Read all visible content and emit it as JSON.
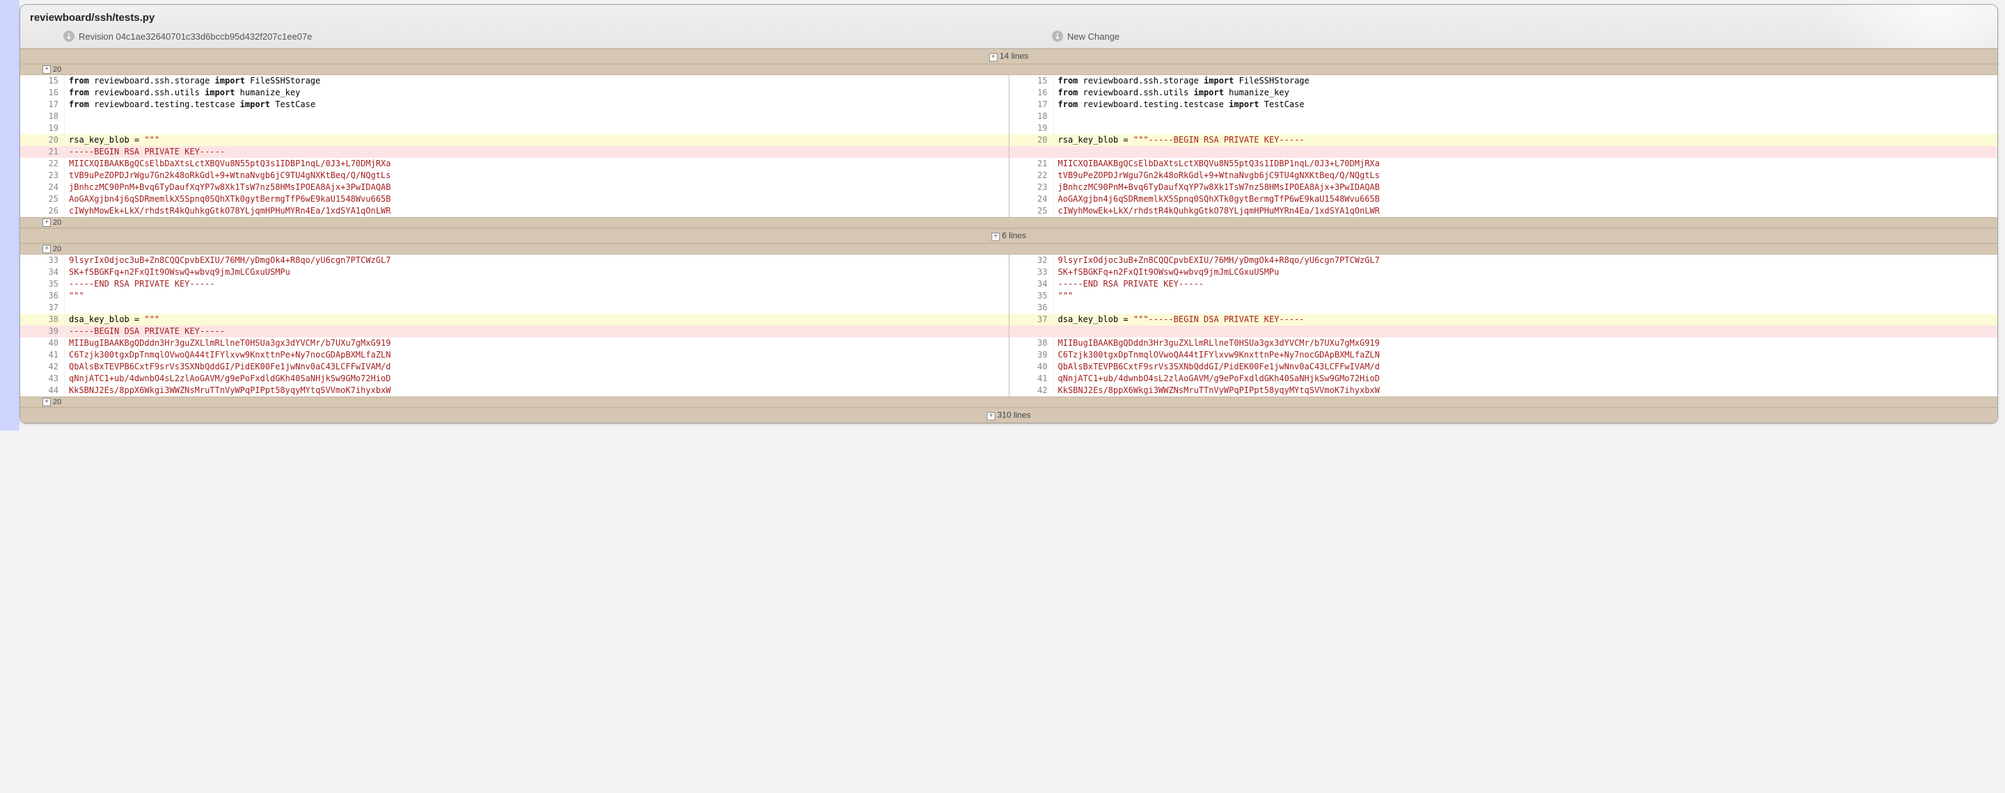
{
  "header": {
    "filepath": "reviewboard/ssh/tests.py",
    "revision_label": "Revision 04c1ae32640701c33d6bccb95d432f207c1ee07e",
    "newchange_label": "New Change"
  },
  "expand_count": "20",
  "bands": {
    "top": "14 lines",
    "mid": "6 lines",
    "bottom": "310 lines"
  },
  "left": {
    "block1": [
      {
        "n": "15",
        "segs": [
          {
            "t": "kw",
            "v": "from"
          },
          {
            "t": "p",
            "v": " reviewboard.ssh.storage "
          },
          {
            "t": "kw",
            "v": "import"
          },
          {
            "t": "p",
            "v": " FileSSHStorage"
          }
        ]
      },
      {
        "n": "16",
        "segs": [
          {
            "t": "kw",
            "v": "from"
          },
          {
            "t": "p",
            "v": " reviewboard.ssh.utils "
          },
          {
            "t": "kw",
            "v": "import"
          },
          {
            "t": "p",
            "v": " humanize_key"
          }
        ]
      },
      {
        "n": "17",
        "segs": [
          {
            "t": "kw",
            "v": "from"
          },
          {
            "t": "p",
            "v": " reviewboard.testing.testcase "
          },
          {
            "t": "kw",
            "v": "import"
          },
          {
            "t": "p",
            "v": " TestCase"
          }
        ]
      },
      {
        "n": "18",
        "segs": []
      },
      {
        "n": "19",
        "segs": []
      },
      {
        "n": "20",
        "cls": "chg",
        "segs": [
          {
            "t": "p",
            "v": "rsa_key_blob = "
          },
          {
            "t": "str",
            "v": "\"\"\""
          }
        ]
      },
      {
        "n": "21",
        "cls": "del",
        "segs": [
          {
            "t": "str",
            "v": "-----BEGIN RSA PRIVATE KEY-----"
          }
        ]
      },
      {
        "n": "22",
        "segs": [
          {
            "t": "str",
            "v": "MIICXQIBAAKBgQCsElbDaXtsLctXBQVu8N55ptQ3s1IDBP1nqL/0J3+L70DMjRXa"
          }
        ]
      },
      {
        "n": "23",
        "segs": [
          {
            "t": "str",
            "v": "tVB9uPeZOPDJrWgu7Gn2k48oRkGdl+9+WtnaNvgb6jC9TU4gNXKtBeq/Q/NQgtLs"
          }
        ]
      },
      {
        "n": "24",
        "segs": [
          {
            "t": "str",
            "v": "jBnhczMC90PnM+Bvq6TyDaufXqYP7w8Xk1TsW7nz58HMsIPOEA8Ajx+3PwIDAQAB"
          }
        ]
      },
      {
        "n": "25",
        "segs": [
          {
            "t": "str",
            "v": "AoGAXgjbn4j6qSDRmemlkX5Spnq0SQhXTk0gytBermgTfP6wE9kaU1548Wvu665B"
          }
        ]
      },
      {
        "n": "26",
        "segs": [
          {
            "t": "str",
            "v": "cIWyhMowEk+LkX/rhdstR4kQuhkgGtkO78YLjqmHPHuMYRn4Ea/1xdSYA1qOnLWR"
          }
        ]
      }
    ],
    "block2": [
      {
        "n": "33",
        "segs": [
          {
            "t": "str",
            "v": "9lsyrIxOdjoc3uB+Zn8CQQCpvbEXIU/76MH/yDmgOk4+R8qo/yU6cgn7PTCWzGL7"
          }
        ]
      },
      {
        "n": "34",
        "segs": [
          {
            "t": "str",
            "v": "SK+fSBGKFq+n2FxQIt9OWswQ+wbvq9jmJmLCGxuUSMPu"
          }
        ]
      },
      {
        "n": "35",
        "segs": [
          {
            "t": "str",
            "v": "-----END RSA PRIVATE KEY-----"
          }
        ]
      },
      {
        "n": "36",
        "segs": [
          {
            "t": "str",
            "v": "\"\"\""
          }
        ]
      },
      {
        "n": "37",
        "segs": []
      },
      {
        "n": "38",
        "cls": "chg",
        "segs": [
          {
            "t": "p",
            "v": "dsa_key_blob = "
          },
          {
            "t": "str",
            "v": "\"\"\""
          }
        ]
      },
      {
        "n": "39",
        "cls": "del",
        "segs": [
          {
            "t": "str",
            "v": "-----BEGIN DSA PRIVATE KEY-----"
          }
        ]
      },
      {
        "n": "40",
        "segs": [
          {
            "t": "str",
            "v": "MIIBugIBAAKBgQDddn3Hr3guZXLlmRLlneT0HSUa3gx3dYVCMr/b7UXu7gMxG919"
          }
        ]
      },
      {
        "n": "41",
        "segs": [
          {
            "t": "str",
            "v": "C6Tzjk300tgxDpTnmqlOVwoQA44tIFYlxvw9KnxttnPe+Ny7nocGDApBXMLfaZLN"
          }
        ]
      },
      {
        "n": "42",
        "segs": [
          {
            "t": "str",
            "v": "QbAlsBxTEVPB6CxtF9srVs3SXNbQddGI/PidEK00Fe1jwNnv0aC43LCFFwIVAM/d"
          }
        ]
      },
      {
        "n": "43",
        "segs": [
          {
            "t": "str",
            "v": "qNnjATC1+ub/4dwnbO4sL2zlAoGAVM/g9ePoFxdldGKh40SaNHjkSw9GMo72HioD"
          }
        ]
      },
      {
        "n": "44",
        "segs": [
          {
            "t": "str",
            "v": "KkSBNJ2Es/8ppX6Wkgi3WWZNsMruTTnVyWPqPIPpt58yqyMYtqSVVmoK7ihyxbxW"
          }
        ]
      }
    ]
  },
  "right": {
    "block1": [
      {
        "n": "15",
        "segs": [
          {
            "t": "kw",
            "v": "from"
          },
          {
            "t": "p",
            "v": " reviewboard.ssh.storage "
          },
          {
            "t": "kw",
            "v": "import"
          },
          {
            "t": "p",
            "v": " FileSSHStorage"
          }
        ]
      },
      {
        "n": "16",
        "segs": [
          {
            "t": "kw",
            "v": "from"
          },
          {
            "t": "p",
            "v": " reviewboard.ssh.utils "
          },
          {
            "t": "kw",
            "v": "import"
          },
          {
            "t": "p",
            "v": " humanize_key"
          }
        ]
      },
      {
        "n": "17",
        "segs": [
          {
            "t": "kw",
            "v": "from"
          },
          {
            "t": "p",
            "v": " reviewboard.testing.testcase "
          },
          {
            "t": "kw",
            "v": "import"
          },
          {
            "t": "p",
            "v": " TestCase"
          }
        ]
      },
      {
        "n": "18",
        "segs": []
      },
      {
        "n": "19",
        "segs": []
      },
      {
        "n": "20",
        "cls": "chg",
        "segs": [
          {
            "t": "p",
            "v": "rsa_key_blob = "
          },
          {
            "t": "str",
            "v": "\"\"\"-----BEGIN RSA PRIVATE KEY-----"
          }
        ]
      },
      {
        "n": "",
        "cls": "del",
        "segs": []
      },
      {
        "n": "21",
        "segs": [
          {
            "t": "str",
            "v": "MIICXQIBAAKBgQCsElbDaXtsLctXBQVu8N55ptQ3s1IDBP1nqL/0J3+L70DMjRXa"
          }
        ]
      },
      {
        "n": "22",
        "segs": [
          {
            "t": "str",
            "v": "tVB9uPeZOPDJrWgu7Gn2k48oRkGdl+9+WtnaNvgb6jC9TU4gNXKtBeq/Q/NQgtLs"
          }
        ]
      },
      {
        "n": "23",
        "segs": [
          {
            "t": "str",
            "v": "jBnhczMC90PnM+Bvq6TyDaufXqYP7w8Xk1TsW7nz58HMsIPOEA8Ajx+3PwIDAQAB"
          }
        ]
      },
      {
        "n": "24",
        "segs": [
          {
            "t": "str",
            "v": "AoGAXgjbn4j6qSDRmemlkX5Spnq0SQhXTk0gytBermgTfP6wE9kaU1548Wvu665B"
          }
        ]
      },
      {
        "n": "25",
        "segs": [
          {
            "t": "str",
            "v": "cIWyhMowEk+LkX/rhdstR4kQuhkgGtkO78YLjqmHPHuMYRn4Ea/1xdSYA1qOnLWR"
          }
        ]
      }
    ],
    "block2": [
      {
        "n": "32",
        "segs": [
          {
            "t": "str",
            "v": "9lsyrIxOdjoc3uB+Zn8CQQCpvbEXIU/76MH/yDmgOk4+R8qo/yU6cgn7PTCWzGL7"
          }
        ]
      },
      {
        "n": "33",
        "segs": [
          {
            "t": "str",
            "v": "SK+fSBGKFq+n2FxQIt9OWswQ+wbvq9jmJmLCGxuUSMPu"
          }
        ]
      },
      {
        "n": "34",
        "segs": [
          {
            "t": "str",
            "v": "-----END RSA PRIVATE KEY-----"
          }
        ]
      },
      {
        "n": "35",
        "segs": [
          {
            "t": "str",
            "v": "\"\"\""
          }
        ]
      },
      {
        "n": "36",
        "segs": []
      },
      {
        "n": "37",
        "cls": "chg",
        "segs": [
          {
            "t": "p",
            "v": "dsa_key_blob = "
          },
          {
            "t": "str",
            "v": "\"\"\"-----BEGIN DSA PRIVATE KEY-----"
          }
        ]
      },
      {
        "n": "",
        "cls": "del",
        "segs": []
      },
      {
        "n": "38",
        "segs": [
          {
            "t": "str",
            "v": "MIIBugIBAAKBgQDddn3Hr3guZXLlmRLlneT0HSUa3gx3dYVCMr/b7UXu7gMxG919"
          }
        ]
      },
      {
        "n": "39",
        "segs": [
          {
            "t": "str",
            "v": "C6Tzjk300tgxDpTnmqlOVwoQA44tIFYlxvw9KnxttnPe+Ny7nocGDApBXMLfaZLN"
          }
        ]
      },
      {
        "n": "40",
        "segs": [
          {
            "t": "str",
            "v": "QbAlsBxTEVPB6CxtF9srVs3SXNbQddGI/PidEK00Fe1jwNnv0aC43LCFFwIVAM/d"
          }
        ]
      },
      {
        "n": "41",
        "segs": [
          {
            "t": "str",
            "v": "qNnjATC1+ub/4dwnbO4sL2zlAoGAVM/g9ePoFxdldGKh40SaNHjkSw9GMo72HioD"
          }
        ]
      },
      {
        "n": "42",
        "segs": [
          {
            "t": "str",
            "v": "KkSBNJ2Es/8ppX6Wkgi3WWZNsMruTTnVyWPqPIPpt58yqyMYtqSVVmoK7ihyxbxW"
          }
        ]
      }
    ]
  }
}
